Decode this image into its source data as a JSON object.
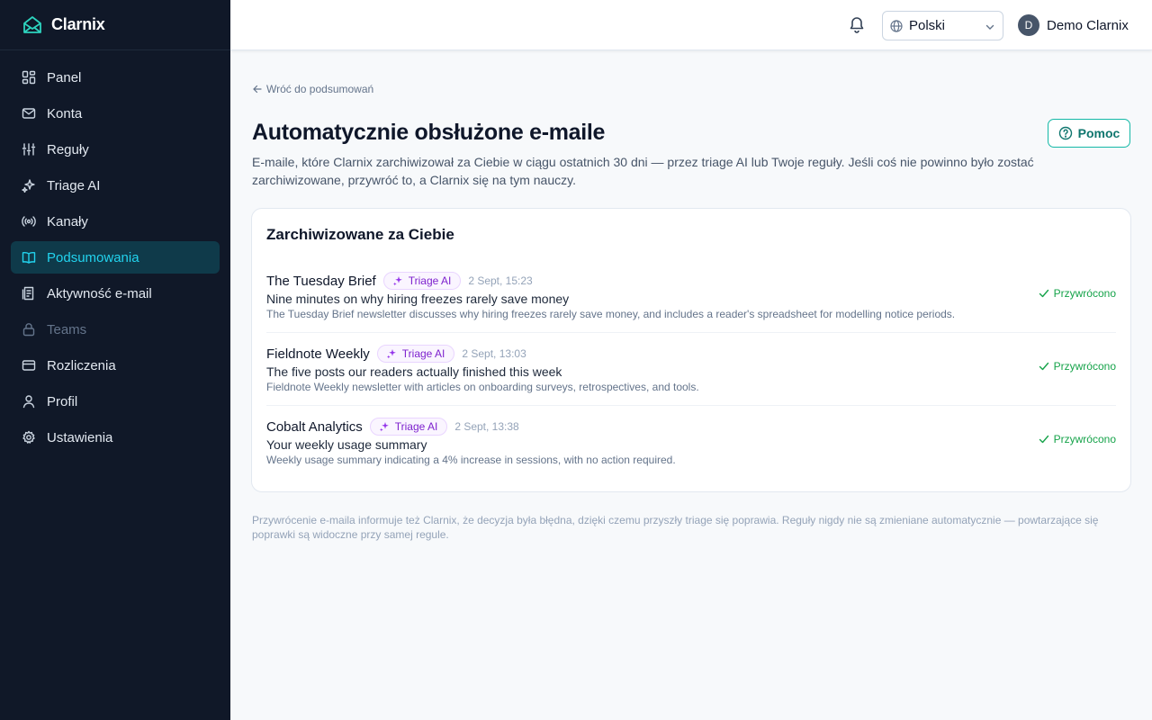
{
  "brand": {
    "name": "Clarnix"
  },
  "sidebar": {
    "items": [
      {
        "label": "Panel",
        "icon": "dashboard-icon"
      },
      {
        "label": "Konta",
        "icon": "mail-icon"
      },
      {
        "label": "Reguły",
        "icon": "sliders-icon"
      },
      {
        "label": "Triage AI",
        "icon": "sparkles-icon"
      },
      {
        "label": "Kanały",
        "icon": "radio-icon"
      },
      {
        "label": "Podsumowania",
        "icon": "book-icon",
        "active": true
      },
      {
        "label": "Aktywność e-mail",
        "icon": "activity-icon"
      },
      {
        "label": "Teams",
        "icon": "lock-icon",
        "disabled": true
      },
      {
        "label": "Rozliczenia",
        "icon": "credit-card-icon"
      },
      {
        "label": "Profil",
        "icon": "user-icon"
      },
      {
        "label": "Ustawienia",
        "icon": "gear-icon"
      }
    ]
  },
  "header": {
    "language": "Polski",
    "user": {
      "initial": "D",
      "name": "Demo Clarnix"
    }
  },
  "main": {
    "back_link": "Wróć do podsumowań",
    "title": "Automatycznie obsłużone e-maile",
    "description": "E-maile, które Clarnix zarchiwizował za Ciebie w ciągu ostatnich 30 dni — przez triage AI lub Twoje reguły. Jeśli coś nie powinno było zostać zarchiwizowane, przywróć to, a Clarnix się na tym nauczy.",
    "help_label": "Pomoc",
    "card": {
      "title": "Zarchiwizowane za Ciebie",
      "emails": [
        {
          "sender": "The Tuesday Brief",
          "badge": "Triage AI",
          "time": "2 Sept, 15:23",
          "subject": "Nine minutes on why hiring freezes rarely save money",
          "summary": "The Tuesday Brief newsletter discusses why hiring freezes rarely save money, and includes a reader's spreadsheet for modelling notice periods.",
          "status": "Przywrócono"
        },
        {
          "sender": "Fieldnote Weekly",
          "badge": "Triage AI",
          "time": "2 Sept, 13:03",
          "subject": "The five posts our readers actually finished this week",
          "summary": "Fieldnote Weekly newsletter with articles on onboarding surveys, retrospectives, and tools.",
          "status": "Przywrócono"
        },
        {
          "sender": "Cobalt Analytics",
          "badge": "Triage AI",
          "time": "2 Sept, 13:38",
          "subject": "Your weekly usage summary",
          "summary": "Weekly usage summary indicating a 4% increase in sessions, with no action required.",
          "status": "Przywrócono"
        }
      ]
    },
    "footnote": "Przywrócenie e-maila informuje też Clarnix, że decyzja była błędna, dzięki czemu przyszły triage się poprawia. Reguły nigdy nie są zmieniane automatycznie — powtarzające się poprawki są widoczne przy samej regule."
  },
  "colors": {
    "sidebar_bg": "#101828",
    "active_text": "#22d3ee",
    "accent": "#14b8a6",
    "badge_purple": "#7e22ce",
    "restored_green": "#16a34a"
  }
}
